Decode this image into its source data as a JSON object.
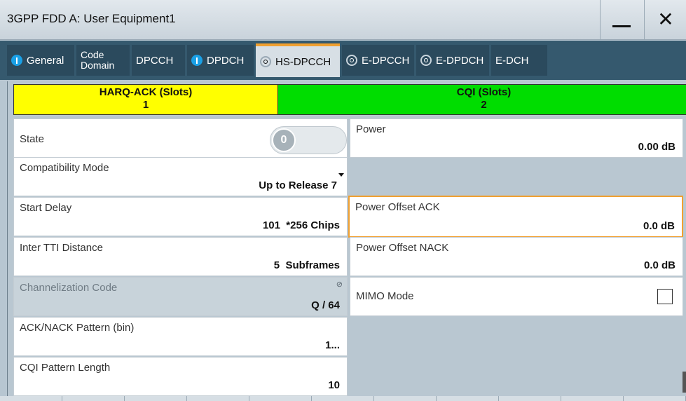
{
  "window": {
    "title": "3GPP FDD A: User Equipment1",
    "minimize_glyph": "—",
    "close_glyph": "✕"
  },
  "tabs": [
    {
      "label": "General",
      "indicator": "on"
    },
    {
      "label": "Code Domain",
      "line1": "Code",
      "line2": "Domain"
    },
    {
      "label": "DPCCH"
    },
    {
      "label": "DPDCH",
      "indicator": "on"
    },
    {
      "label": "HS-DPCCH",
      "indicator": "off",
      "active": true
    },
    {
      "label": "E-DPCCH",
      "indicator": "off"
    },
    {
      "label": "E-DPDCH",
      "indicator": "off"
    },
    {
      "label": "E-DCH"
    }
  ],
  "slots": {
    "harq": {
      "label": "HARQ-ACK (Slots)",
      "value": "1",
      "color": "#ffff00"
    },
    "cqi": {
      "label": "CQI (Slots)",
      "value": "2",
      "color": "#00dd00"
    }
  },
  "left": {
    "state": {
      "label": "State",
      "toggle_text": "0",
      "on": false
    },
    "compat": {
      "label": "Compatibility Mode",
      "value": "Up to Release 7"
    },
    "start_delay": {
      "label": "Start Delay",
      "value": "101  *256 Chips"
    },
    "inter_tti": {
      "label": "Inter TTI Distance",
      "value": "5  Subframes"
    },
    "chan_code": {
      "label": "Channelization Code",
      "value": "Q / 64",
      "disabled": true
    },
    "ack_nack": {
      "label": "ACK/NACK Pattern (bin)",
      "value": "1..."
    },
    "cqi_len": {
      "label": "CQI Pattern Length",
      "value": "10"
    }
  },
  "right": {
    "power": {
      "label": "Power",
      "value": "0.00 dB"
    },
    "offset_ack": {
      "label": "Power Offset ACK",
      "value": "0.0 dB"
    },
    "offset_nack": {
      "label": "Power Offset NACK",
      "value": "0.0 dB"
    },
    "mimo": {
      "label": "MIMO Mode",
      "checked": false
    }
  },
  "colors": {
    "accent": "#f0a030",
    "tabbar": "#35596e",
    "indicator_on": "#1aa0e6"
  }
}
